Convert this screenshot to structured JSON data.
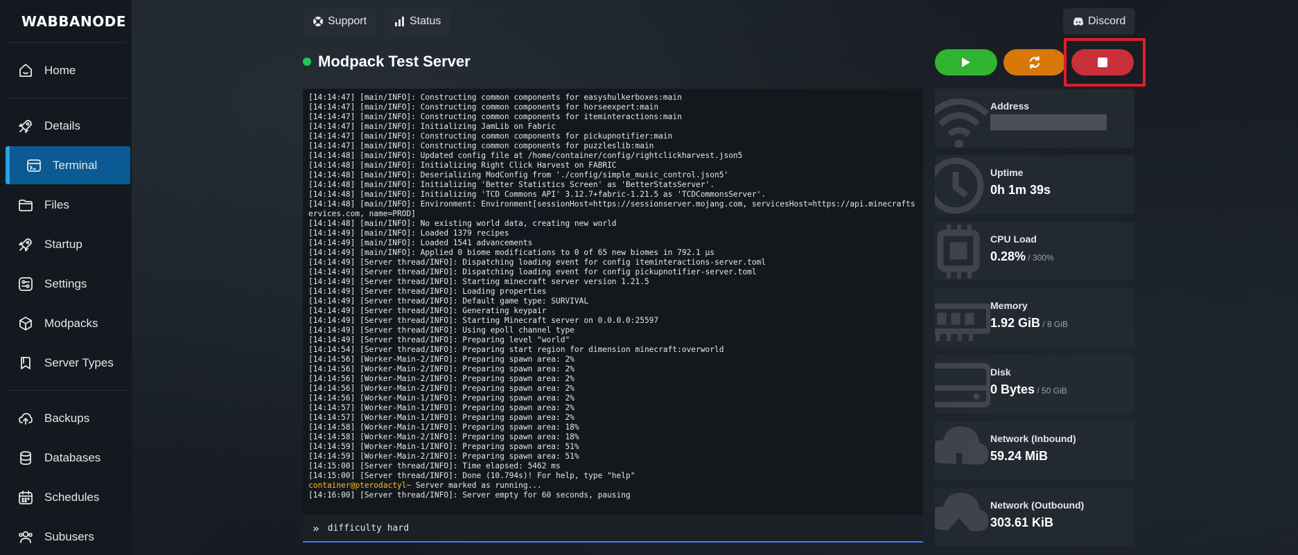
{
  "brand": {
    "name": "WABBANODE"
  },
  "nav": {
    "group1": [
      {
        "label": "Home",
        "icon": "home-icon"
      }
    ],
    "group2": [
      {
        "label": "Details",
        "icon": "rocket-icon"
      },
      {
        "label": "Terminal",
        "icon": "terminal-icon",
        "active": true
      },
      {
        "label": "Files",
        "icon": "folder-icon"
      },
      {
        "label": "Startup",
        "icon": "rocket-icon"
      },
      {
        "label": "Settings",
        "icon": "sliders-icon"
      },
      {
        "label": "Modpacks",
        "icon": "cube-icon"
      },
      {
        "label": "Server Types",
        "icon": "bookmark-icon"
      }
    ],
    "group3": [
      {
        "label": "Backups",
        "icon": "cloud-upload-icon"
      },
      {
        "label": "Databases",
        "icon": "database-icon"
      },
      {
        "label": "Schedules",
        "icon": "calendar-icon"
      },
      {
        "label": "Subusers",
        "icon": "users-icon"
      }
    ]
  },
  "topbar": {
    "support": "Support",
    "status": "Status",
    "discord": "Discord"
  },
  "server": {
    "name": "Modpack Test Server",
    "status_color": "#22c55e"
  },
  "terminal": {
    "lines": [
      "[14:14:47] [main/INFO]: Constructing common components for easyshulkerboxes:main",
      "[14:14:47] [main/INFO]: Constructing common components for horseexpert:main",
      "[14:14:47] [main/INFO]: Constructing common components for iteminteractions:main",
      "[14:14:47] [main/INFO]: Initializing JamLib on Fabric",
      "[14:14:47] [main/INFO]: Constructing common components for pickupnotifier:main",
      "[14:14:47] [main/INFO]: Constructing common components for puzzleslib:main",
      "[14:14:48] [main/INFO]: Updated config file at /home/container/config/rightclickharvest.json5",
      "[14:14:48] [main/INFO]: Initializing Right Click Harvest on FABRIC",
      "[14:14:48] [main/INFO]: Deserializing ModConfig from './config/simple_music_control.json5'",
      "[14:14:48] [main/INFO]: Initializing 'Better Statistics Screen' as 'BetterStatsServer'.",
      "[14:14:48] [main/INFO]: Initializing 'TCD Commons API' 3.12.7+fabric-1.21.5 as 'TCDCommonsServer'.",
      "[14:14:48] [main/INFO]: Environment: Environment[sessionHost=https://sessionserver.mojang.com, servicesHost=https://api.minecraftservices.com, name=PROD]",
      "[14:14:48] [main/INFO]: No existing world data, creating new world",
      "[14:14:49] [main/INFO]: Loaded 1379 recipes",
      "[14:14:49] [main/INFO]: Loaded 1541 advancements",
      "[14:14:49] [main/INFO]: Applied 0 biome modifications to 0 of 65 new biomes in 792.1 µs",
      "[14:14:49] [Server thread/INFO]: Dispatching loading event for config iteminteractions-server.toml",
      "[14:14:49] [Server thread/INFO]: Dispatching loading event for config pickupnotifier-server.toml",
      "[14:14:49] [Server thread/INFO]: Starting minecraft server version 1.21.5",
      "[14:14:49] [Server thread/INFO]: Loading properties",
      "[14:14:49] [Server thread/INFO]: Default game type: SURVIVAL",
      "[14:14:49] [Server thread/INFO]: Generating keypair",
      "[14:14:49] [Server thread/INFO]: Starting Minecraft server on 0.0.0.0:25597",
      "[14:14:49] [Server thread/INFO]: Using epoll channel type",
      "[14:14:49] [Server thread/INFO]: Preparing level \"world\"",
      "[14:14:54] [Server thread/INFO]: Preparing start region for dimension minecraft:overworld",
      "[14:14:56] [Worker-Main-2/INFO]: Preparing spawn area: 2%",
      "[14:14:56] [Worker-Main-2/INFO]: Preparing spawn area: 2%",
      "[14:14:56] [Worker-Main-2/INFO]: Preparing spawn area: 2%",
      "[14:14:56] [Worker-Main-2/INFO]: Preparing spawn area: 2%",
      "[14:14:56] [Worker-Main-1/INFO]: Preparing spawn area: 2%",
      "[14:14:57] [Worker-Main-1/INFO]: Preparing spawn area: 2%",
      "[14:14:57] [Worker-Main-1/INFO]: Preparing spawn area: 2%",
      "[14:14:58] [Worker-Main-1/INFO]: Preparing spawn area: 18%",
      "[14:14:58] [Worker-Main-2/INFO]: Preparing spawn area: 18%",
      "[14:14:59] [Worker-Main-1/INFO]: Preparing spawn area: 51%",
      "[14:14:59] [Worker-Main-2/INFO]: Preparing spawn area: 51%",
      "[14:15:00] [Server thread/INFO]: Time elapsed: 5462 ms",
      "[14:15:00] [Server thread/INFO]: Done (10.794s)! For help, type \"help\""
    ],
    "prompt": "container@pterodactyl~",
    "prompt_text": " Server marked as running...",
    "last_line": "[14:16:00] [Server thread/INFO]: Server empty for 60 seconds, pausing",
    "command_value": "difficulty hard"
  },
  "stats": [
    {
      "label": "Address",
      "value": "",
      "redacted": true,
      "icon": "wifi-icon"
    },
    {
      "label": "Uptime",
      "value": "0h 1m 39s",
      "icon": "clock-icon"
    },
    {
      "label": "CPU Load",
      "value": "0.28%",
      "suffix": "/ 300%",
      "icon": "cpu-icon"
    },
    {
      "label": "Memory",
      "value": "1.92 GiB",
      "suffix": "/ 8 GiB",
      "icon": "memory-icon"
    },
    {
      "label": "Disk",
      "value": "0 Bytes",
      "suffix": "/ 50 GiB",
      "icon": "disk-icon"
    },
    {
      "label": "Network (Inbound)",
      "value": "59.24 MiB",
      "icon": "cloud-download-icon"
    },
    {
      "label": "Network (Outbound)",
      "value": "303.61 KiB",
      "icon": "cloud-upload-icon"
    }
  ]
}
